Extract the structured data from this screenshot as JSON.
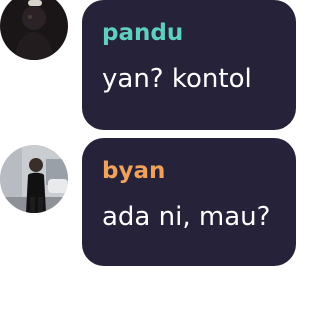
{
  "messages": [
    {
      "sender": "pandu",
      "text": "yan? kontol",
      "sender_color": "#5fd0c0",
      "avatar_icon": "user-avatar-pandu-dark-icon"
    },
    {
      "sender": "byan",
      "text": "ada ni, mau?",
      "sender_color": "#f0a25a",
      "avatar_icon": "user-avatar-byan-street-icon"
    }
  ],
  "colors": {
    "bubble_background": "#26223a",
    "message_text": "#ffffff",
    "page_background": "#ffffff"
  }
}
